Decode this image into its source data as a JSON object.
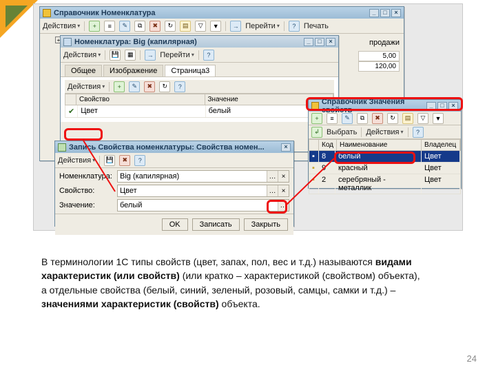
{
  "corner": true,
  "win_nomenclature": {
    "title": "Справочник Номенклатура",
    "actions": "Действия",
    "tb_icons": [
      "plus",
      "list",
      "edit",
      "copy",
      "del",
      "refresh",
      "filter",
      "tree"
    ],
    "go": "Перейти",
    "help": "?",
    "print": "Печать",
    "tree_label": "продажи",
    "vals": [
      "5,00",
      "120,00"
    ]
  },
  "win_item": {
    "title": "Номенклатура: Big (капилярная)",
    "actions": "Действия",
    "go": "Перейти",
    "help": "?",
    "tabs": [
      "Общее",
      "Изображение",
      "Страница3"
    ],
    "active_tab": 2,
    "sub_actions": "Действия",
    "grid_headers": [
      "Свойство",
      "Значение"
    ],
    "grid_row": [
      "Цвет",
      "белый"
    ]
  },
  "win_record": {
    "title": "Запись Свойства номенклатуры: Свойства номен...",
    "actions": "Действия",
    "fields": [
      {
        "label": "Номенклатура:",
        "value": "Big (капилярная)"
      },
      {
        "label": "Свойство:",
        "value": "Цвет"
      },
      {
        "label": "Значение:",
        "value": "белый"
      }
    ],
    "buttons": {
      "ok": "OK",
      "save": "Записать",
      "close": "Закрыть"
    }
  },
  "win_values": {
    "title": "Справочник Значения свойств",
    "select": "Выбрать",
    "actions": "Действия",
    "headers": [
      "",
      "Код",
      "Наименование",
      "Владелец"
    ],
    "rows": [
      {
        "code": "8",
        "name": "белый",
        "owner": "Цвет",
        "sel": true
      },
      {
        "code": "9",
        "name": "красный",
        "owner": "Цвет"
      },
      {
        "code": "2",
        "name": "серебряный - металлик",
        "owner": "Цвет"
      }
    ]
  },
  "explain": {
    "t1": "В терминологии 1С типы свойств (цвет, запах, пол, вес и т.д.) называются ",
    "b1": "видами характеристик (или свойств)",
    "t2": " (или кратко – характеристикой (свойством) объекта), а отдельные свойства (белый, синий, зеленый, розовый, самцы, самки и т.д.) – ",
    "b2": "значениями характеристик (свойств)",
    "t3": " объекта."
  },
  "page": "24"
}
